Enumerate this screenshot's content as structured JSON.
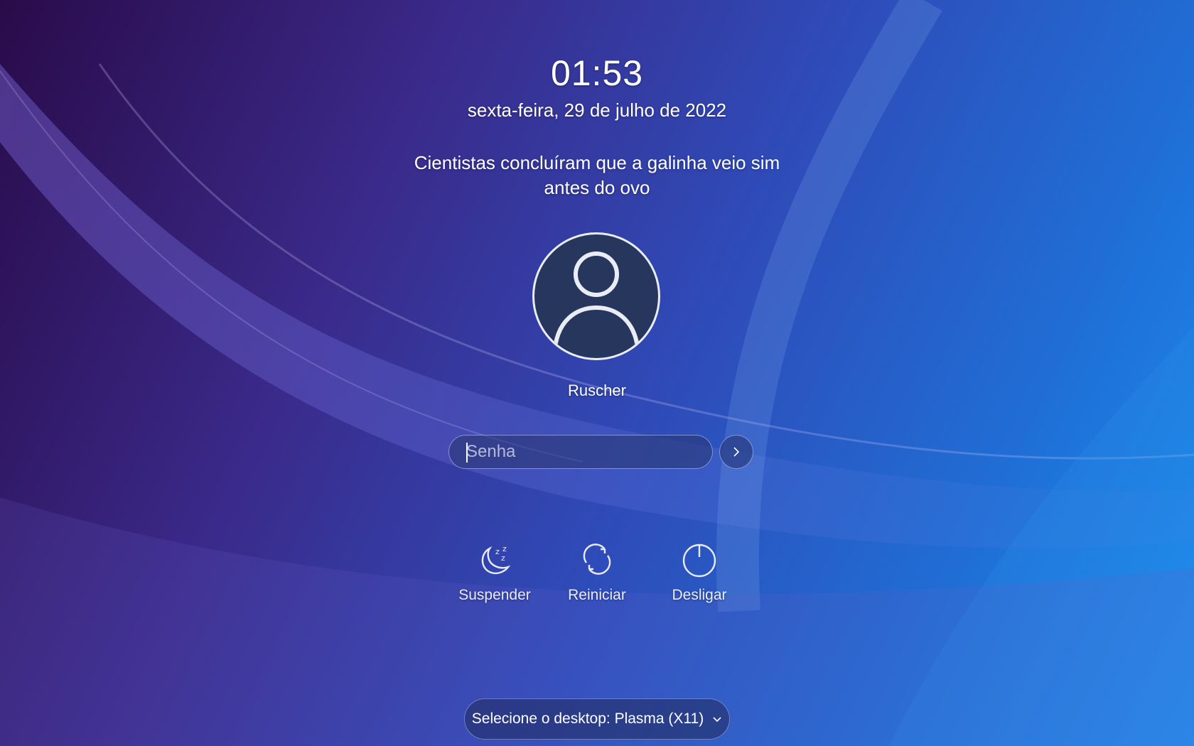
{
  "clock": {
    "time": "01:53",
    "date": "sexta-feira, 29 de julho de 2022"
  },
  "lock_message": "Cientistas concluíram que a galinha veio sim antes do ovo",
  "user": {
    "name": "Ruscher",
    "avatar_icon": "user-avatar-icon"
  },
  "password": {
    "placeholder": "Senha",
    "value": ""
  },
  "login_button": {
    "icon": "chevron-right-icon"
  },
  "actions": [
    {
      "label": "Suspender",
      "icon": "moon-sleep-icon"
    },
    {
      "label": "Reiniciar",
      "icon": "restart-icon"
    },
    {
      "label": "Desligar",
      "icon": "power-icon"
    }
  ],
  "session": {
    "label": "Selecione o desktop: Plasma (X11)",
    "icon": "chevron-down-icon"
  },
  "colors": {
    "accent": "#3daee9",
    "avatar_bg": "#26365c"
  }
}
